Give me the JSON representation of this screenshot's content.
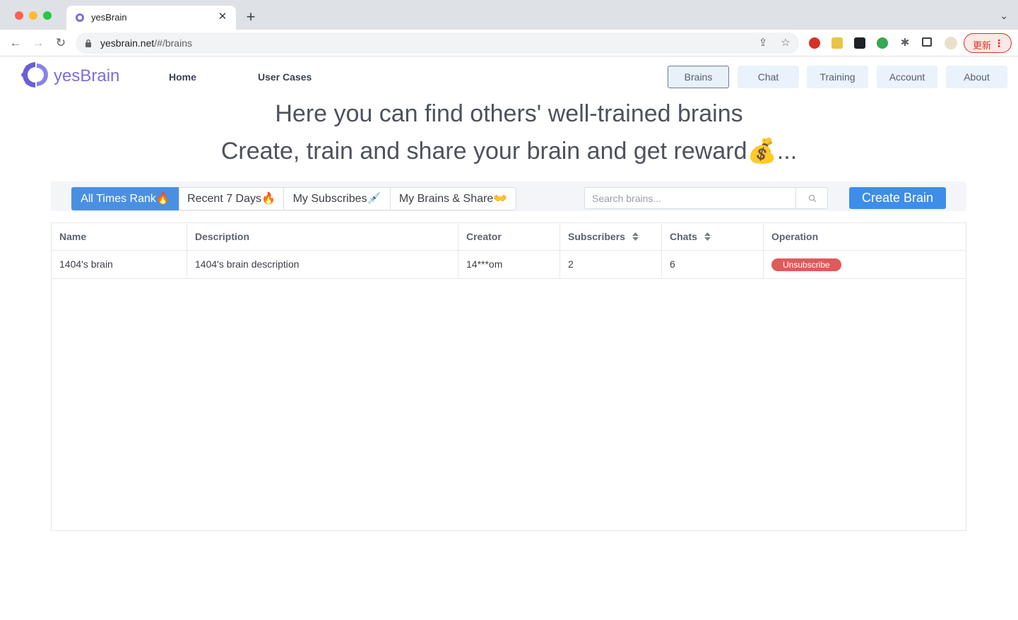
{
  "browser": {
    "tab_title": "yesBrain",
    "tab_close": "✕",
    "new_tab": "+",
    "url_host": "yesbrain.net",
    "url_path": "/#/brains",
    "update_label": "更新",
    "menu_dots": "⋮",
    "nav_back": "←",
    "nav_forward": "→",
    "nav_reload": "↻",
    "share_icon": "⇪",
    "star_icon": "☆",
    "dropdown": "⌄"
  },
  "header": {
    "brand": "yesBrain",
    "links": [
      {
        "label": "Home"
      },
      {
        "label": "User Cases"
      }
    ],
    "buttons": [
      {
        "label": "Brains",
        "active": true
      },
      {
        "label": "Chat"
      },
      {
        "label": "Training"
      },
      {
        "label": "Account"
      },
      {
        "label": "About"
      }
    ]
  },
  "hero": {
    "line1": "Here you can find others' well-trained brains",
    "line2": "Create, train and share your brain and get reward💰..."
  },
  "filters": {
    "tabs": [
      {
        "label": "All Times Rank🔥",
        "active": true
      },
      {
        "label": "Recent 7 Days🔥"
      },
      {
        "label": "My Subscribes💉"
      },
      {
        "label": "My Brains & Share👐"
      }
    ],
    "search_placeholder": "Search brains...",
    "create_label": "Create Brain"
  },
  "table": {
    "columns": [
      "Name",
      "Description",
      "Creator",
      "Subscribers",
      "Chats",
      "Operation"
    ],
    "rows": [
      {
        "name": "1404's brain",
        "description": "1404's brain description",
        "creator": "14***om",
        "subscribers": "2",
        "chats": "6",
        "operation": "Unsubscribe"
      }
    ]
  },
  "colors": {
    "brand": "#7a6fe0",
    "primary": "#3d8ee8",
    "danger": "#e05a5a"
  }
}
